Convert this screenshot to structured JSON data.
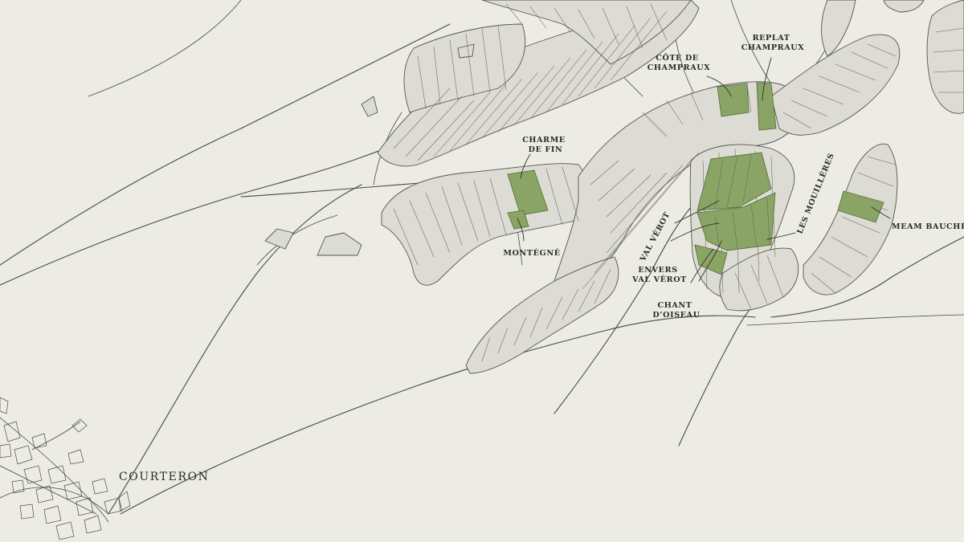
{
  "map": {
    "colors": {
      "background": "#ecebe4",
      "parcel_fill": "#dcdcd4",
      "parcel_stroke": "#55554f",
      "road": "#4a4a46",
      "highlight_fill": "#8aa466",
      "highlight_stroke": "#5b7440",
      "label": "#2b2b28"
    },
    "town": {
      "name": "COURTERON"
    },
    "lieux_dits": {
      "replat_champraux": [
        "REPLAT",
        "CHAMPRAUX"
      ],
      "cote_de_champraux": [
        "CÔTE DE",
        "CHAMPRAUX"
      ],
      "charme_de_fin": [
        "CHARME",
        "DE FIN"
      ],
      "montegne": [
        "MONTÉGNÉ"
      ],
      "val_verot": [
        "VAL VÉROT"
      ],
      "envers_val_verot": [
        "ENVERS",
        "VAL VÉROT"
      ],
      "chant_doiseau": [
        "CHANT",
        "D’OISEAU"
      ],
      "les_mouilleres": [
        "LES MOUILLÈRES"
      ],
      "meam_bauche": [
        "MEAM BAUCHÉ"
      ]
    }
  }
}
